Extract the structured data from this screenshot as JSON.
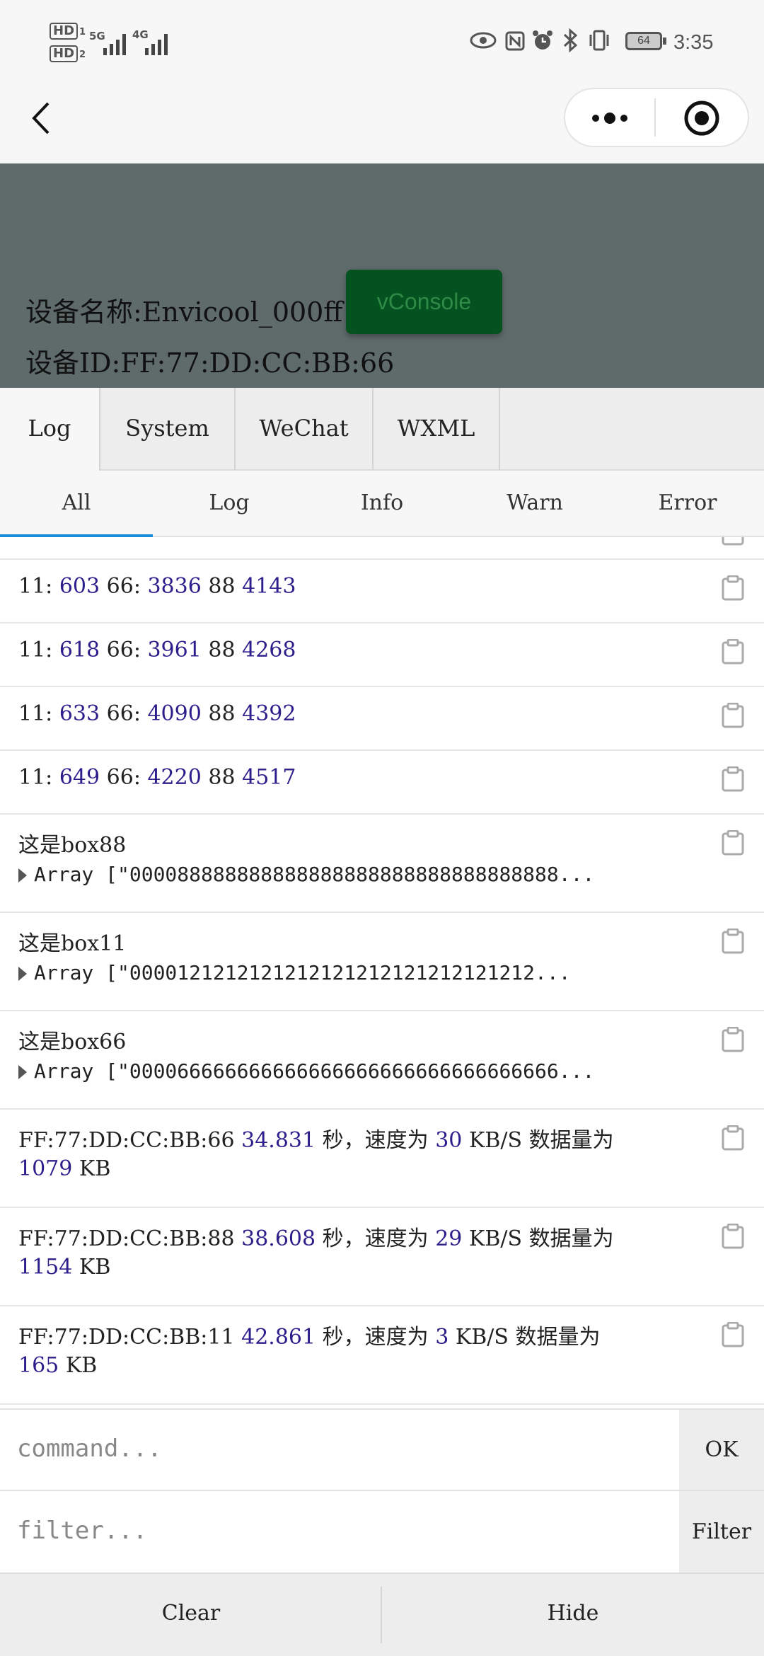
{
  "status_bar": {
    "hd1": "HD",
    "hd1_sim": "1",
    "hd2": "HD",
    "hd2_sim": "2",
    "net1": "5G",
    "net2": "4G",
    "battery_level": "64",
    "time": "3:35",
    "icons": [
      "eye-icon",
      "nfc-icon",
      "alarm-icon",
      "bluetooth-icon",
      "vibrate-icon",
      "battery-icon"
    ]
  },
  "navbar": {
    "back_icon": "chevron-left-icon",
    "more_icon": "more-dots-icon",
    "close_icon": "target-circle-icon"
  },
  "device": {
    "name_line": "设备名称:Envicool_000ff",
    "id_line": "设备ID:FF:77:DD:CC:BB:66"
  },
  "vconsole_button": "vConsole",
  "tabs": [
    "Log",
    "System",
    "WeChat",
    "WXML"
  ],
  "subtabs": [
    "All",
    "Log",
    "Info",
    "Warn",
    "Error"
  ],
  "log_rows": [
    {
      "k1": "11:",
      "v1": "603",
      "k2": "66:",
      "v2": "3836",
      "k3": "88",
      "v3": "4143"
    },
    {
      "k1": "11:",
      "v1": "618",
      "k2": "66:",
      "v2": "3961",
      "k3": "88",
      "v3": "4268"
    },
    {
      "k1": "11:",
      "v1": "633",
      "k2": "66:",
      "v2": "4090",
      "k3": "88",
      "v3": "4392"
    },
    {
      "k1": "11:",
      "v1": "649",
      "k2": "66:",
      "v2": "4220",
      "k3": "88",
      "v3": "4517"
    }
  ],
  "box_rows": [
    {
      "title": "这是box88",
      "array": "Array [\"000088888888888888888888888888888888..."
    },
    {
      "title": "这是box11",
      "array": "Array [\"0000121212121212121212121212121212..."
    },
    {
      "title": "这是box66",
      "array": "Array [\"000066666666666666666666666666666666..."
    }
  ],
  "speed_rows": [
    {
      "device": "FF:77:DD:CC:BB:66",
      "time": "34.831",
      "sec": "秒，速度为",
      "speed": "30",
      "unit": "KB/S",
      "label": "数据量为",
      "size": "1079",
      "size_unit": "KB"
    },
    {
      "device": "FF:77:DD:CC:BB:88",
      "time": "38.608",
      "sec": "秒，速度为",
      "speed": "29",
      "unit": "KB/S",
      "label": "数据量为",
      "size": "1154",
      "size_unit": "KB"
    },
    {
      "device": "FF:77:DD:CC:BB:11",
      "time": "42.861",
      "sec": "秒，速度为",
      "speed": "3",
      "unit": "KB/S",
      "label": "数据量为",
      "size": "165",
      "size_unit": "KB"
    }
  ],
  "command": {
    "placeholder": "command...",
    "button": "OK"
  },
  "filter": {
    "placeholder": "filter...",
    "button": "Filter"
  },
  "bottom_buttons": {
    "clear": "Clear",
    "hide": "Hide"
  }
}
